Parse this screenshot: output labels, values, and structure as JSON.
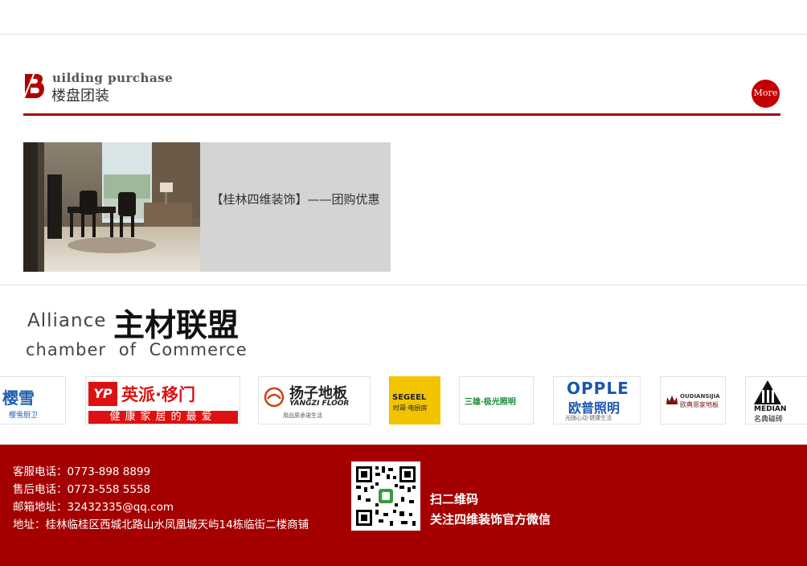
{
  "section_logo": {
    "english": "uilding purchase",
    "chinese": "楼盘团装"
  },
  "more_button": "More",
  "promo": {
    "title": "【桂林四维装饰】——团购优惠"
  },
  "alliance": {
    "en_line1": "Alliance",
    "cn_title": "主材联盟",
    "en_line2": "chamber of Commerce"
  },
  "brands": [
    {
      "id": "brand-yingxue",
      "name": "樱雪",
      "sub": "樱雪厨卫"
    },
    {
      "id": "brand-yingpai",
      "name": "英派·移门",
      "sub": "健康家居的最爱",
      "mark": "YP"
    },
    {
      "id": "brand-yangzi",
      "name": "扬子地板",
      "en": "YANGZI FLOOR",
      "sub": "用品质承诺生活"
    },
    {
      "id": "brand-segeel",
      "name": "SEGEEL",
      "sub": "时哥·电厨房"
    },
    {
      "id": "brand-sanxiong",
      "name": "三雄·极光照明"
    },
    {
      "id": "brand-opple",
      "name": "OPPLE",
      "cn": "欧普照明",
      "sub": "光随心动·健康生活"
    },
    {
      "id": "brand-oudian",
      "name": "OUDIANSIJIA",
      "cn": "欧典思家地板"
    },
    {
      "id": "brand-median",
      "name": "MEDIAN",
      "cn": "名典磁砖"
    }
  ],
  "footer": {
    "service_phone": "客服电话：0773-898 8899",
    "aftersale_phone": "售后电话：0773-558 5558",
    "email": "邮箱地址：32432335@qq.com",
    "address": "地址：桂林临桂区西城北路山水凤凰城天屿14栋临街二楼商铺",
    "qr_line1": "扫二维码",
    "qr_line2": "关注四维装饰官方微信"
  },
  "colors": {
    "brand_red": "#a50000",
    "accent_red": "#c40000",
    "promo_bg": "#d4d4d4"
  }
}
